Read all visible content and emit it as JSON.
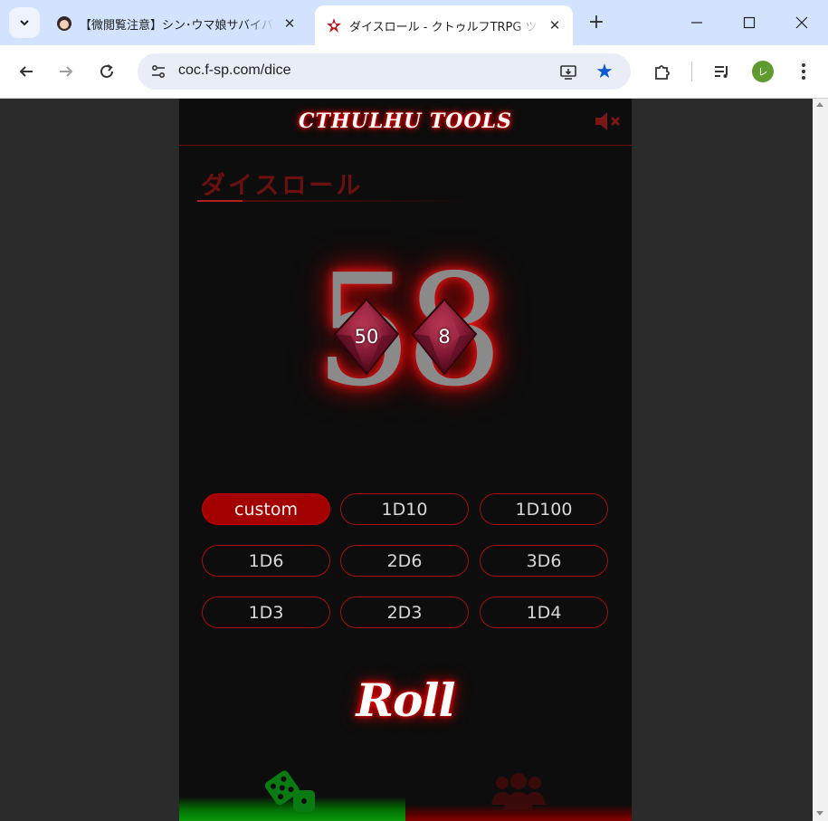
{
  "browser": {
    "tabs": [
      {
        "title": "【微閲覧注意】シン･ウマ娘サバイバル",
        "active": false
      },
      {
        "title": "ダイスロール - クトゥルフTRPG ツール",
        "active": true
      }
    ],
    "url": "coc.f-sp.com/dice",
    "profile_initial": "レ",
    "accent_color": "#0b57d0"
  },
  "site": {
    "logo_text": "CTHULHU TOOLS",
    "section_title": "ダイスロール",
    "roll_label": "Roll",
    "accent_red": "#a30000",
    "nav_dice_color": "#0a9a0a",
    "nav_party_color": "#8a0000"
  },
  "result": {
    "total": "58",
    "dice": [
      "50",
      "8"
    ]
  },
  "dice_buttons": [
    {
      "label": "custom",
      "selected": true
    },
    {
      "label": "1D10",
      "selected": false
    },
    {
      "label": "1D100",
      "selected": false
    },
    {
      "label": "1D6",
      "selected": false
    },
    {
      "label": "2D6",
      "selected": false
    },
    {
      "label": "3D6",
      "selected": false
    },
    {
      "label": "1D3",
      "selected": false
    },
    {
      "label": "2D3",
      "selected": false
    },
    {
      "label": "1D4",
      "selected": false
    }
  ],
  "icons": {
    "mute": "volume-mute-icon",
    "nav_dice": "dice-icon",
    "nav_party": "users-icon"
  }
}
